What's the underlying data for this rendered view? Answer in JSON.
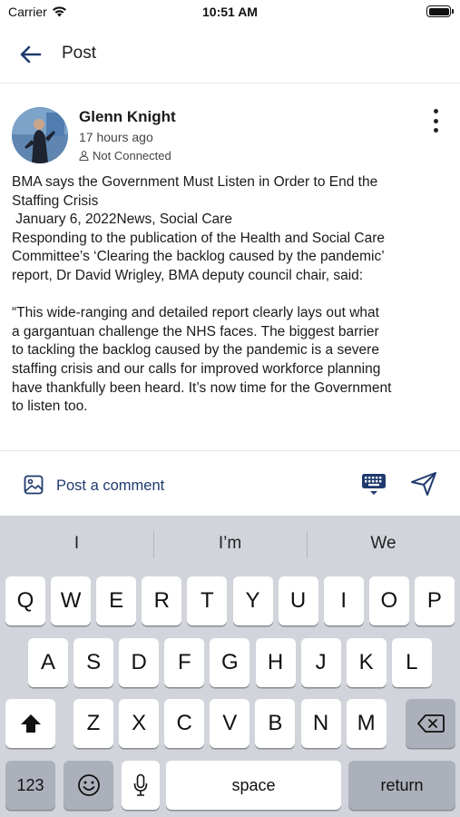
{
  "status_bar": {
    "carrier": "Carrier",
    "time": "10:51 AM"
  },
  "header": {
    "title": "Post",
    "back_icon": "arrow-left-icon"
  },
  "post": {
    "author": "Glenn Knight",
    "time": "17 hours ago",
    "connection_status": "Not Connected",
    "lines": [
      "BMA says the Government Must Listen in Order to End the",
      "Staffing Crisis",
      " January 6, 2022News, Social Care",
      "Responding to the publication of the Health and Social Care",
      "Committee’s ‘Clearing the backlog caused by the pandemic’",
      "report, Dr David Wrigley, BMA deputy council chair, said:",
      "",
      "“This wide-ranging and detailed report clearly lays out what",
      "a gargantuan challenge the NHS faces. The biggest barrier",
      "to tackling the backlog caused by the pandemic is a severe",
      "staffing crisis and our calls for improved workforce planning",
      "have thankfully been heard. It’s now time for the Government",
      "to listen too."
    ]
  },
  "comment_bar": {
    "placeholder": "Post a comment"
  },
  "keyboard": {
    "suggestions": [
      "I",
      "I’m",
      "We"
    ],
    "row1": [
      "Q",
      "W",
      "E",
      "R",
      "T",
      "Y",
      "U",
      "I",
      "O",
      "P"
    ],
    "row2": [
      "A",
      "S",
      "D",
      "F",
      "G",
      "H",
      "J",
      "K",
      "L"
    ],
    "row3": [
      "Z",
      "X",
      "C",
      "V",
      "B",
      "N",
      "M"
    ],
    "numbers_label": "123",
    "space_label": "space",
    "return_label": "return"
  },
  "colors": {
    "accent": "#1f3a6e",
    "keyboard_bg": "#d1d4db",
    "key_dark": "#abb0ba"
  }
}
